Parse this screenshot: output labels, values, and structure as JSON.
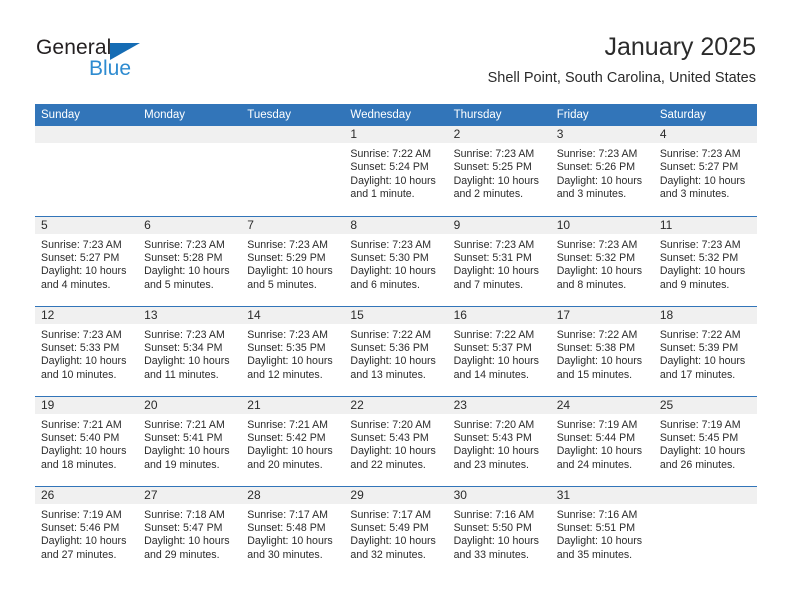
{
  "brand": {
    "name_top": "General",
    "name_bottom": "Blue",
    "color_dark": "#231f20",
    "color_blue": "#2e8bd0",
    "triangle_color": "#156cb4"
  },
  "header": {
    "title": "January 2025",
    "subtitle": "Shell Point, South Carolina, United States"
  },
  "theme": {
    "header_bg": "#3275b9",
    "daynum_bg": "#f0f0f0",
    "cell_bg": "#ffffff",
    "text": "#2b2b2b"
  },
  "calendar": {
    "weekday_headers": [
      "Sunday",
      "Monday",
      "Tuesday",
      "Wednesday",
      "Thursday",
      "Friday",
      "Saturday"
    ],
    "weeks": [
      [
        {
          "day": "",
          "sunrise": "",
          "sunset": "",
          "daylight_line1": "",
          "daylight_line2": ""
        },
        {
          "day": "",
          "sunrise": "",
          "sunset": "",
          "daylight_line1": "",
          "daylight_line2": ""
        },
        {
          "day": "",
          "sunrise": "",
          "sunset": "",
          "daylight_line1": "",
          "daylight_line2": ""
        },
        {
          "day": "1",
          "sunrise": "Sunrise: 7:22 AM",
          "sunset": "Sunset: 5:24 PM",
          "daylight_line1": "Daylight: 10 hours",
          "daylight_line2": "and 1 minute."
        },
        {
          "day": "2",
          "sunrise": "Sunrise: 7:23 AM",
          "sunset": "Sunset: 5:25 PM",
          "daylight_line1": "Daylight: 10 hours",
          "daylight_line2": "and 2 minutes."
        },
        {
          "day": "3",
          "sunrise": "Sunrise: 7:23 AM",
          "sunset": "Sunset: 5:26 PM",
          "daylight_line1": "Daylight: 10 hours",
          "daylight_line2": "and 3 minutes."
        },
        {
          "day": "4",
          "sunrise": "Sunrise: 7:23 AM",
          "sunset": "Sunset: 5:27 PM",
          "daylight_line1": "Daylight: 10 hours",
          "daylight_line2": "and 3 minutes."
        }
      ],
      [
        {
          "day": "5",
          "sunrise": "Sunrise: 7:23 AM",
          "sunset": "Sunset: 5:27 PM",
          "daylight_line1": "Daylight: 10 hours",
          "daylight_line2": "and 4 minutes."
        },
        {
          "day": "6",
          "sunrise": "Sunrise: 7:23 AM",
          "sunset": "Sunset: 5:28 PM",
          "daylight_line1": "Daylight: 10 hours",
          "daylight_line2": "and 5 minutes."
        },
        {
          "day": "7",
          "sunrise": "Sunrise: 7:23 AM",
          "sunset": "Sunset: 5:29 PM",
          "daylight_line1": "Daylight: 10 hours",
          "daylight_line2": "and 5 minutes."
        },
        {
          "day": "8",
          "sunrise": "Sunrise: 7:23 AM",
          "sunset": "Sunset: 5:30 PM",
          "daylight_line1": "Daylight: 10 hours",
          "daylight_line2": "and 6 minutes."
        },
        {
          "day": "9",
          "sunrise": "Sunrise: 7:23 AM",
          "sunset": "Sunset: 5:31 PM",
          "daylight_line1": "Daylight: 10 hours",
          "daylight_line2": "and 7 minutes."
        },
        {
          "day": "10",
          "sunrise": "Sunrise: 7:23 AM",
          "sunset": "Sunset: 5:32 PM",
          "daylight_line1": "Daylight: 10 hours",
          "daylight_line2": "and 8 minutes."
        },
        {
          "day": "11",
          "sunrise": "Sunrise: 7:23 AM",
          "sunset": "Sunset: 5:32 PM",
          "daylight_line1": "Daylight: 10 hours",
          "daylight_line2": "and 9 minutes."
        }
      ],
      [
        {
          "day": "12",
          "sunrise": "Sunrise: 7:23 AM",
          "sunset": "Sunset: 5:33 PM",
          "daylight_line1": "Daylight: 10 hours",
          "daylight_line2": "and 10 minutes."
        },
        {
          "day": "13",
          "sunrise": "Sunrise: 7:23 AM",
          "sunset": "Sunset: 5:34 PM",
          "daylight_line1": "Daylight: 10 hours",
          "daylight_line2": "and 11 minutes."
        },
        {
          "day": "14",
          "sunrise": "Sunrise: 7:23 AM",
          "sunset": "Sunset: 5:35 PM",
          "daylight_line1": "Daylight: 10 hours",
          "daylight_line2": "and 12 minutes."
        },
        {
          "day": "15",
          "sunrise": "Sunrise: 7:22 AM",
          "sunset": "Sunset: 5:36 PM",
          "daylight_line1": "Daylight: 10 hours",
          "daylight_line2": "and 13 minutes."
        },
        {
          "day": "16",
          "sunrise": "Sunrise: 7:22 AM",
          "sunset": "Sunset: 5:37 PM",
          "daylight_line1": "Daylight: 10 hours",
          "daylight_line2": "and 14 minutes."
        },
        {
          "day": "17",
          "sunrise": "Sunrise: 7:22 AM",
          "sunset": "Sunset: 5:38 PM",
          "daylight_line1": "Daylight: 10 hours",
          "daylight_line2": "and 15 minutes."
        },
        {
          "day": "18",
          "sunrise": "Sunrise: 7:22 AM",
          "sunset": "Sunset: 5:39 PM",
          "daylight_line1": "Daylight: 10 hours",
          "daylight_line2": "and 17 minutes."
        }
      ],
      [
        {
          "day": "19",
          "sunrise": "Sunrise: 7:21 AM",
          "sunset": "Sunset: 5:40 PM",
          "daylight_line1": "Daylight: 10 hours",
          "daylight_line2": "and 18 minutes."
        },
        {
          "day": "20",
          "sunrise": "Sunrise: 7:21 AM",
          "sunset": "Sunset: 5:41 PM",
          "daylight_line1": "Daylight: 10 hours",
          "daylight_line2": "and 19 minutes."
        },
        {
          "day": "21",
          "sunrise": "Sunrise: 7:21 AM",
          "sunset": "Sunset: 5:42 PM",
          "daylight_line1": "Daylight: 10 hours",
          "daylight_line2": "and 20 minutes."
        },
        {
          "day": "22",
          "sunrise": "Sunrise: 7:20 AM",
          "sunset": "Sunset: 5:43 PM",
          "daylight_line1": "Daylight: 10 hours",
          "daylight_line2": "and 22 minutes."
        },
        {
          "day": "23",
          "sunrise": "Sunrise: 7:20 AM",
          "sunset": "Sunset: 5:43 PM",
          "daylight_line1": "Daylight: 10 hours",
          "daylight_line2": "and 23 minutes."
        },
        {
          "day": "24",
          "sunrise": "Sunrise: 7:19 AM",
          "sunset": "Sunset: 5:44 PM",
          "daylight_line1": "Daylight: 10 hours",
          "daylight_line2": "and 24 minutes."
        },
        {
          "day": "25",
          "sunrise": "Sunrise: 7:19 AM",
          "sunset": "Sunset: 5:45 PM",
          "daylight_line1": "Daylight: 10 hours",
          "daylight_line2": "and 26 minutes."
        }
      ],
      [
        {
          "day": "26",
          "sunrise": "Sunrise: 7:19 AM",
          "sunset": "Sunset: 5:46 PM",
          "daylight_line1": "Daylight: 10 hours",
          "daylight_line2": "and 27 minutes."
        },
        {
          "day": "27",
          "sunrise": "Sunrise: 7:18 AM",
          "sunset": "Sunset: 5:47 PM",
          "daylight_line1": "Daylight: 10 hours",
          "daylight_line2": "and 29 minutes."
        },
        {
          "day": "28",
          "sunrise": "Sunrise: 7:17 AM",
          "sunset": "Sunset: 5:48 PM",
          "daylight_line1": "Daylight: 10 hours",
          "daylight_line2": "and 30 minutes."
        },
        {
          "day": "29",
          "sunrise": "Sunrise: 7:17 AM",
          "sunset": "Sunset: 5:49 PM",
          "daylight_line1": "Daylight: 10 hours",
          "daylight_line2": "and 32 minutes."
        },
        {
          "day": "30",
          "sunrise": "Sunrise: 7:16 AM",
          "sunset": "Sunset: 5:50 PM",
          "daylight_line1": "Daylight: 10 hours",
          "daylight_line2": "and 33 minutes."
        },
        {
          "day": "31",
          "sunrise": "Sunrise: 7:16 AM",
          "sunset": "Sunset: 5:51 PM",
          "daylight_line1": "Daylight: 10 hours",
          "daylight_line2": "and 35 minutes."
        },
        {
          "day": "",
          "sunrise": "",
          "sunset": "",
          "daylight_line1": "",
          "daylight_line2": ""
        }
      ]
    ]
  }
}
